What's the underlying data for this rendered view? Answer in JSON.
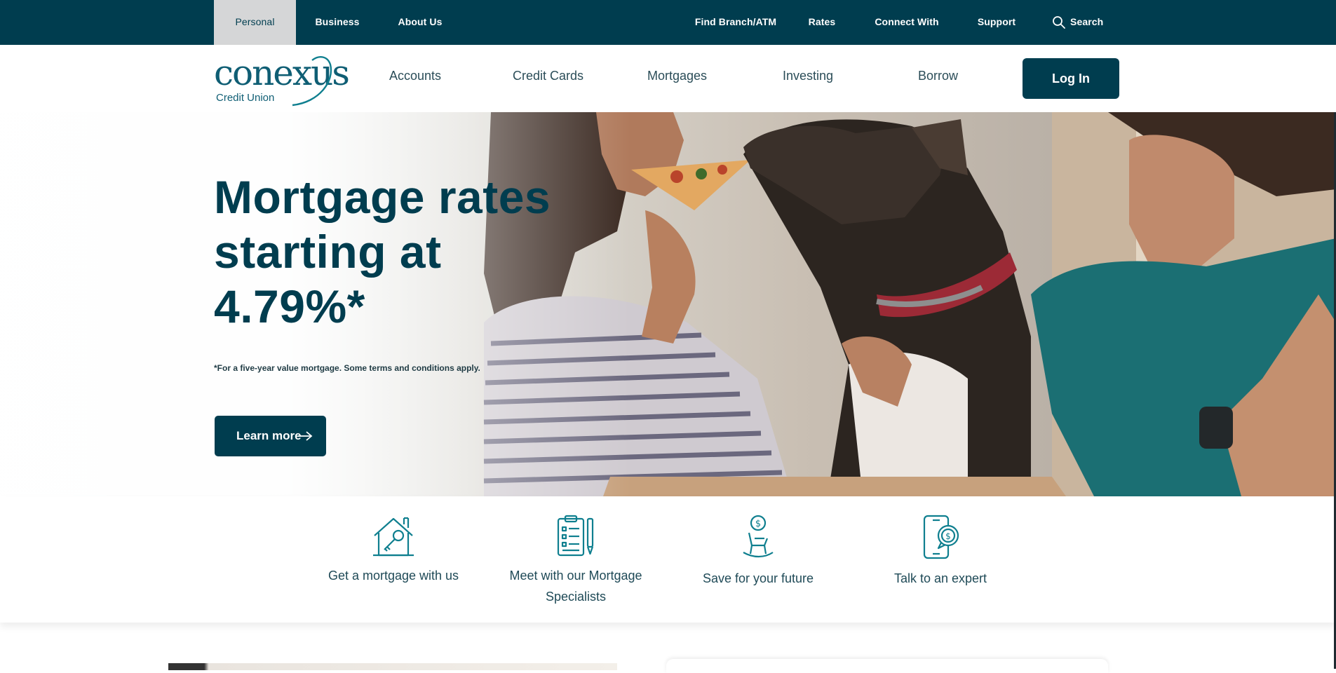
{
  "topbar": {
    "segments": [
      "Personal",
      "Business",
      "About Us"
    ],
    "links": [
      "Find Branch/ATM",
      "Rates",
      "Connect With Us",
      "Support"
    ],
    "search_label": "Search"
  },
  "logo": {
    "wordmark": "conexus",
    "sub": "Credit Union"
  },
  "mainnav": {
    "items": [
      "Accounts",
      "Credit Cards",
      "Mortgages",
      "Investing",
      "Borrow"
    ],
    "login_label": "Log In"
  },
  "hero": {
    "title": "Mortgage rates starting at 4.79%*",
    "note": "*For a five-year value mortgage. Some terms and conditions apply.",
    "cta_label": "Learn more"
  },
  "features": [
    {
      "label": "Get a mortgage with us",
      "icon": "house-key-icon"
    },
    {
      "label": "Meet with our Mortgage Specialists",
      "icon": "checklist-pen-icon"
    },
    {
      "label": "Save for your future",
      "icon": "rocking-chair-coin-icon"
    },
    {
      "label": "Talk to an expert",
      "icon": "phone-chat-dollar-icon"
    }
  ],
  "colors": {
    "brand_dark": "#003d4f",
    "brand_teal": "#0f7f8f",
    "active_tab_bg": "#d5d6d7"
  }
}
